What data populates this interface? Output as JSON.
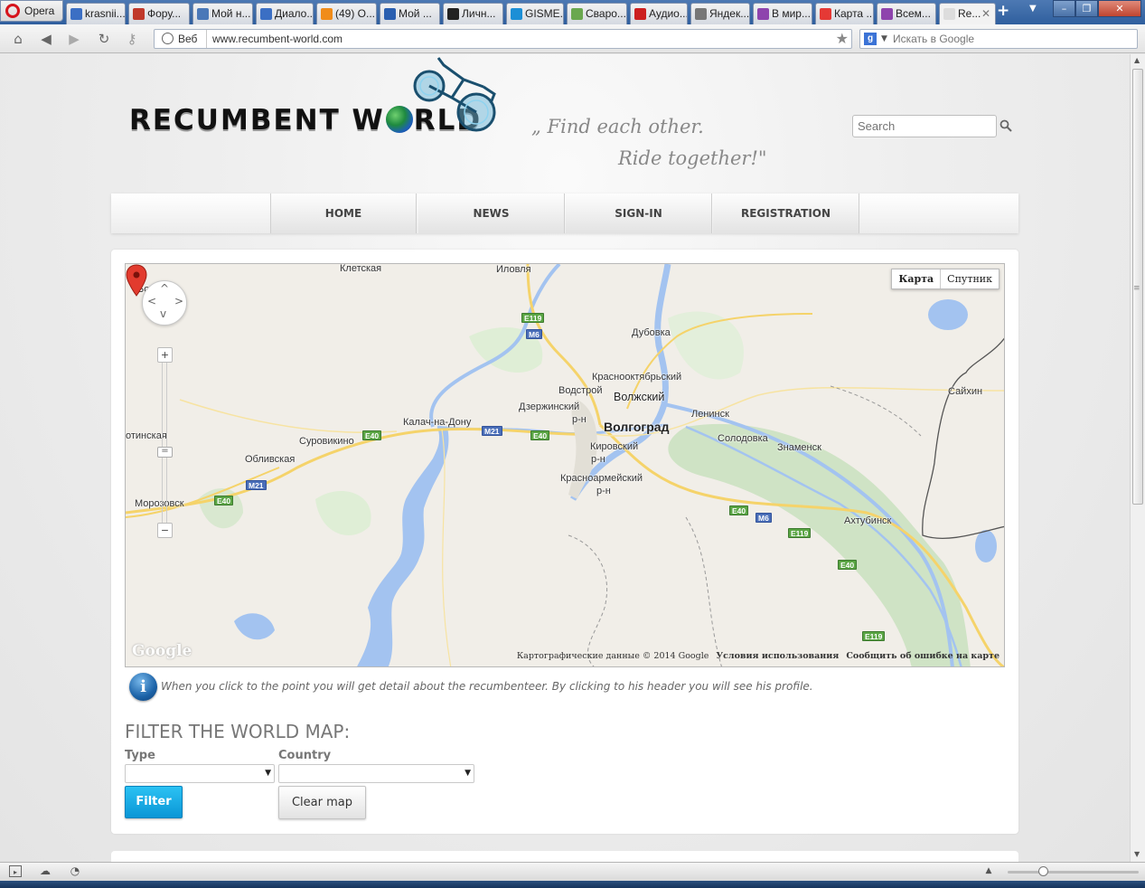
{
  "browser": {
    "menu_label": "Opera",
    "tabs": [
      {
        "label": "krasnii...",
        "color": "#3b6fc4"
      },
      {
        "label": "Фору...",
        "color": "#c0392b"
      },
      {
        "label": "Мой н...",
        "color": "#4a78b8"
      },
      {
        "label": "Диало...",
        "color": "#3b6fc4"
      },
      {
        "label": "(49) О...",
        "color": "#f08c1a"
      },
      {
        "label": "Мой ...",
        "color": "#2a5fb0"
      },
      {
        "label": "Личн...",
        "color": "#222222"
      },
      {
        "label": "GISME...",
        "color": "#1c8fd6"
      },
      {
        "label": "Сваро...",
        "color": "#6aa84f"
      },
      {
        "label": "Аудио...",
        "color": "#cc1f1f"
      },
      {
        "label": "Яндек...",
        "color": "#777777"
      },
      {
        "label": "В мир...",
        "color": "#8e44ad"
      },
      {
        "label": "Карта ...",
        "color": "#e53935"
      },
      {
        "label": "Всем...",
        "color": "#8e44ad"
      },
      {
        "label": "Re...",
        "color": "#dddddd"
      }
    ],
    "new_tab_label": "+",
    "web_label": "Веб",
    "url": "www.recumbent-world.com",
    "search_engine_label": "g",
    "search_placeholder": "Искать в Google"
  },
  "site": {
    "logo_left": "RECUMBENT W",
    "logo_right": "RLD",
    "tagline_line1": "„ Find each other.",
    "tagline_line2": "Ride together!\"",
    "search_placeholder": "Search",
    "menu": [
      "HOME",
      "NEWS",
      "SIGN-IN",
      "REGISTRATION"
    ]
  },
  "map": {
    "type_buttons": {
      "map": "Карта",
      "satellite": "Спутник"
    },
    "zoom_in": "+",
    "zoom_out": "−",
    "zoom_level_fraction": 0.55,
    "google_logo": "Google",
    "attribution": "Картографические данные © 2014 Google",
    "terms": "Условия использования",
    "report": "Сообщить об ошибке на карте",
    "places": {
      "kletskaya": "Клетская",
      "ilovlya": "Иловля",
      "bo": "Бо",
      "dubovka": "Дубовка",
      "krasnooktyabrsky": "Краснооктябрьский",
      "vodstroy": "Водстрой",
      "volzhsky": "Волжский",
      "dzerzhinsky_1": "Дзержинский",
      "dzerzhinsky_2": "р-н",
      "volgograd": "Волгоград",
      "leninsk": "Ленинск",
      "saikhin": "Сайхин",
      "kalach": "Калач-на-Дону",
      "otinskaya": "отинская",
      "surovikino": "Суровикино",
      "oblivskaya": "Обливская",
      "kirovsky_1": "Кировский",
      "kirovsky_2": "р-н",
      "solodovka": "Солодовка",
      "znamensk": "Знаменск",
      "krasnoarm_1": "Красноармейский",
      "krasnoarm_2": "р-н",
      "morozovsk": "Морозовск",
      "akhtubinsk": "Ахтубинск"
    },
    "shields": {
      "e119_a": "E119",
      "m6_a": "M6",
      "e40_a": "E40",
      "m21_a": "M21",
      "e40_b": "E40",
      "m21_b": "M21",
      "e40_c": "E40",
      "e40_d": "E40",
      "m6_b": "M6",
      "e119_b": "E119",
      "e40_e": "E40",
      "e119_c": "E119"
    }
  },
  "info_text": "When you click to the point you will get detail about the recumbenteer. By clicking to his header you will see his profile.",
  "filter": {
    "title": "FILTER THE WORLD MAP:",
    "type_label": "Type",
    "country_label": "Country",
    "type_value": "",
    "country_value": "",
    "filter_button": "Filter",
    "clear_button": "Clear map"
  },
  "colors": {
    "water": "#a3c3f0",
    "land": "#f1eee8",
    "green": "#cfe3c5",
    "road": "#f5d36a",
    "accent": "#0ea5e4"
  }
}
